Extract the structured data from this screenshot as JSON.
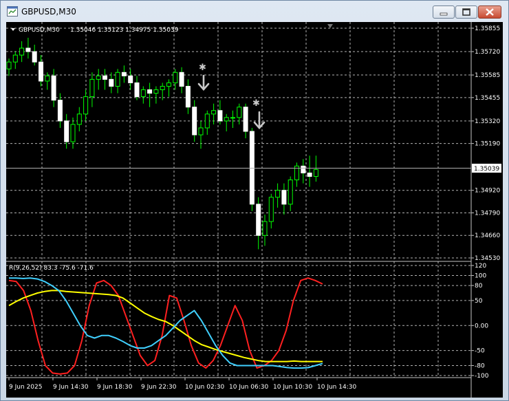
{
  "window": {
    "title": "GBPUSD,M30",
    "buttons": [
      "minimize",
      "maximize",
      "close"
    ]
  },
  "chart_header": {
    "symbol_tf": "GBPUSD,M30",
    "ohlc": "1.35046 1.35123 1.34975 1.35039"
  },
  "indicator_label": "R(9,26,52) 83.3 -75.6 -71.6",
  "colors": {
    "background": "#000000",
    "grid": "#b4b4b4",
    "candle": "#ffffff",
    "wick": "#00ff00",
    "line_red": "#ff2020",
    "line_yellow": "#ffff00",
    "line_cyan": "#40d0ff",
    "arrow": "#c8c8c8"
  },
  "chart_data": [
    {
      "type": "candlestick",
      "title": "GBPUSD,M30",
      "symbol": "GBPUSD",
      "timeframe": "M30",
      "price_ticks": [
        "1.35855",
        "1.35720",
        "1.35585",
        "1.35455",
        "1.35320",
        "1.35190",
        "1.34920",
        "1.34790",
        "1.34660",
        "1.34530"
      ],
      "price_range": [
        1.3453,
        1.3587
      ],
      "current_price": "1.35039",
      "candles": [
        [
          1.3562,
          1.3568,
          1.3558,
          1.3566
        ],
        [
          1.3566,
          1.3572,
          1.3562,
          1.357
        ],
        [
          1.357,
          1.3578,
          1.3566,
          1.3574
        ],
        [
          1.3574,
          1.358,
          1.3568,
          1.3572
        ],
        [
          1.3572,
          1.3576,
          1.3564,
          1.3566
        ],
        [
          1.3566,
          1.357,
          1.3552,
          1.3555
        ],
        [
          1.3555,
          1.356,
          1.355,
          1.3558
        ],
        [
          1.3558,
          1.3562,
          1.354,
          1.3544
        ],
        [
          1.3544,
          1.3548,
          1.3528,
          1.3532
        ],
        [
          1.3532,
          1.3536,
          1.3516,
          1.352
        ],
        [
          1.352,
          1.3534,
          1.3516,
          1.353
        ],
        [
          1.353,
          1.354,
          1.3526,
          1.3536
        ],
        [
          1.3536,
          1.355,
          1.3532,
          1.3546
        ],
        [
          1.3546,
          1.356,
          1.354,
          1.3556
        ],
        [
          1.3556,
          1.3562,
          1.355,
          1.3558
        ],
        [
          1.3558,
          1.3562,
          1.355,
          1.3556
        ],
        [
          1.3556,
          1.356,
          1.3548,
          1.3552
        ],
        [
          1.3552,
          1.3562,
          1.3548,
          1.356
        ],
        [
          1.356,
          1.3564,
          1.3554,
          1.3558
        ],
        [
          1.3558,
          1.3562,
          1.355,
          1.3554
        ],
        [
          1.3554,
          1.3558,
          1.3544,
          1.3546
        ],
        [
          1.3546,
          1.3552,
          1.3542,
          1.355
        ],
        [
          1.355,
          1.3554,
          1.354,
          1.3548
        ],
        [
          1.3548,
          1.3552,
          1.3542,
          1.355
        ],
        [
          1.355,
          1.3554,
          1.3544,
          1.3552
        ],
        [
          1.3552,
          1.3556,
          1.3546,
          1.3554
        ],
        [
          1.3554,
          1.3562,
          1.355,
          1.356
        ],
        [
          1.356,
          1.3563,
          1.3548,
          1.3552
        ],
        [
          1.3552,
          1.3556,
          1.3536,
          1.354
        ],
        [
          1.354,
          1.3544,
          1.352,
          1.3524
        ],
        [
          1.3524,
          1.3532,
          1.3516,
          1.3528
        ],
        [
          1.3528,
          1.3538,
          1.3524,
          1.3536
        ],
        [
          1.3536,
          1.3542,
          1.353,
          1.3538
        ],
        [
          1.3538,
          1.3544,
          1.353,
          1.3532
        ],
        [
          1.3532,
          1.3536,
          1.3526,
          1.3534
        ],
        [
          1.3534,
          1.3538,
          1.3528,
          1.3534
        ],
        [
          1.3534,
          1.3542,
          1.353,
          1.354
        ],
        [
          1.354,
          1.3542,
          1.3522,
          1.3526
        ],
        [
          1.3526,
          1.3528,
          1.348,
          1.3484
        ],
        [
          1.3484,
          1.3488,
          1.3458,
          1.3466
        ],
        [
          1.3466,
          1.3478,
          1.346,
          1.3474
        ],
        [
          1.3474,
          1.349,
          1.347,
          1.3488
        ],
        [
          1.3488,
          1.3496,
          1.3482,
          1.3492
        ],
        [
          1.3492,
          1.3496,
          1.3478,
          1.3484
        ],
        [
          1.3484,
          1.35,
          1.348,
          1.3498
        ],
        [
          1.3498,
          1.3508,
          1.3494,
          1.3506
        ],
        [
          1.3506,
          1.351,
          1.3496,
          1.3502
        ],
        [
          1.3502,
          1.3512,
          1.3494,
          1.35
        ],
        [
          1.35,
          1.3512,
          1.3497,
          1.3504
        ]
      ]
    },
    {
      "type": "line",
      "label": "R(9,26,52) 83.3 -75.6 -71.6",
      "y_ticks": [
        "120",
        "100",
        "80",
        "50",
        "0.00",
        "-50",
        "-80",
        "-100"
      ],
      "y_range": [
        -110,
        120
      ],
      "x_labels": [
        "9 Jun 2025",
        "9 Jun 14:30",
        "9 Jun 18:30",
        "9 Jun 22:30",
        "10 Jun 02:30",
        "10 Jun 06:30",
        "10 Jun 10:30",
        "10 Jun 14:30"
      ],
      "series": [
        {
          "color": "#ff2020",
          "values": [
            90,
            88,
            70,
            30,
            -30,
            -80,
            -95,
            -97,
            -95,
            -80,
            -30,
            40,
            85,
            90,
            80,
            60,
            20,
            -20,
            -60,
            -80,
            -70,
            -20,
            60,
            55,
            10,
            -40,
            -75,
            -85,
            -70,
            -40,
            0,
            40,
            10,
            -50,
            -85,
            -80,
            -70,
            -50,
            -10,
            50,
            90,
            95,
            90,
            83
          ]
        },
        {
          "color": "#ffff00",
          "values": [
            40,
            48,
            55,
            60,
            65,
            68,
            70,
            70,
            68,
            67,
            66,
            65,
            64,
            63,
            62,
            60,
            55,
            45,
            35,
            25,
            18,
            12,
            8,
            0,
            -10,
            -20,
            -30,
            -38,
            -43,
            -48,
            -52,
            -56,
            -60,
            -64,
            -67,
            -70,
            -72,
            -72,
            -72,
            -72,
            -71,
            -72,
            -72,
            -72,
            -72
          ]
        },
        {
          "color": "#40d0ff",
          "values": [
            95,
            95,
            94,
            95,
            93,
            88,
            80,
            70,
            50,
            25,
            0,
            -20,
            -25,
            -20,
            -20,
            -25,
            -32,
            -40,
            -45,
            -45,
            -40,
            -30,
            -20,
            -5,
            10,
            20,
            30,
            10,
            -15,
            -40,
            -60,
            -75,
            -80,
            -80,
            -80,
            -80,
            -80,
            -80,
            -82,
            -84,
            -85,
            -85,
            -84,
            -80,
            -76
          ]
        }
      ]
    }
  ]
}
